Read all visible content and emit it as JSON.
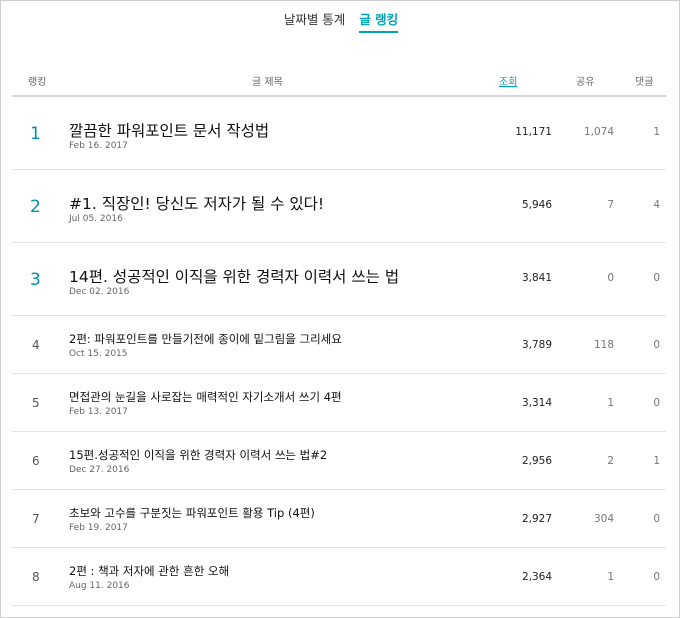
{
  "tabs": [
    {
      "label": "날짜별 통계",
      "active": false
    },
    {
      "label": "글 랭킹",
      "active": true
    }
  ],
  "table": {
    "headers": {
      "rank": "랭킹",
      "title": "글 제목",
      "views": "조회",
      "share": "공유",
      "comments": "댓글"
    },
    "rows": [
      {
        "rank": "1",
        "title": "깔끔한 파워포인트 문서 작성법",
        "date": "Feb 16. 2017",
        "views": "11,171",
        "share": "1,074",
        "comments": "1"
      },
      {
        "rank": "2",
        "title": "#1. 직장인! 당신도 저자가 될 수 있다!",
        "date": "Jul 05. 2016",
        "views": "5,946",
        "share": "7",
        "comments": "4"
      },
      {
        "rank": "3",
        "title": "14편. 성공적인 이직을 위한 경력자 이력서 쓰는 법",
        "date": "Dec 02. 2016",
        "views": "3,841",
        "share": "0",
        "comments": "0"
      },
      {
        "rank": "4",
        "title": "2편: 파워포인트를 만들기전에 종이에 밑그림을 그리세요",
        "date": "Oct 15. 2015",
        "views": "3,789",
        "share": "118",
        "comments": "0"
      },
      {
        "rank": "5",
        "title": "면접관의 눈길을 사로잡는 매력적인 자기소개서 쓰기 4편",
        "date": "Feb 13. 2017",
        "views": "3,314",
        "share": "1",
        "comments": "0"
      },
      {
        "rank": "6",
        "title": "15편.성공적인 이직을 위한 경력자 이력서 쓰는 법#2",
        "date": "Dec 27. 2016",
        "views": "2,956",
        "share": "2",
        "comments": "1"
      },
      {
        "rank": "7",
        "title": "초보와 고수를 구분짓는 파워포인트 활용 Tip (4편)",
        "date": "Feb 19. 2017",
        "views": "2,927",
        "share": "304",
        "comments": "0"
      },
      {
        "rank": "8",
        "title": "2편 : 책과 저자에 관한 흔한 오해",
        "date": "Aug 11. 2016",
        "views": "2,364",
        "share": "1",
        "comments": "0"
      }
    ]
  },
  "colors": {
    "accent": "#00a5b5",
    "top_rank": "#00909e"
  }
}
